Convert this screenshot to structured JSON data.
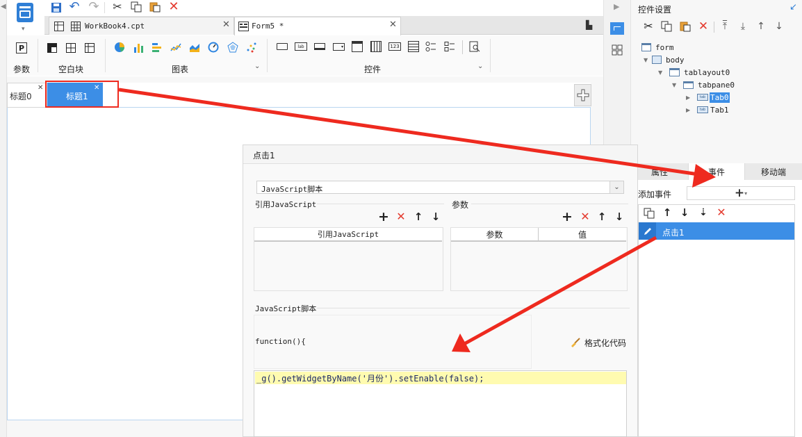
{
  "toolbar": {
    "groups": {
      "params": "参数",
      "blank": "空白块",
      "charts": "图表",
      "widgets": "控件"
    }
  },
  "tabs": [
    {
      "label": "WorkBook4.cpt"
    },
    {
      "label": "Form5 *"
    }
  ],
  "form_tabs": [
    {
      "label": "标题0"
    },
    {
      "label": "标题1"
    }
  ],
  "side": {
    "title": "控件设置",
    "tree": [
      {
        "label": "form"
      },
      {
        "label": "body"
      },
      {
        "label": "tablayout0"
      },
      {
        "label": "tabpane0"
      },
      {
        "label": "Tab0"
      },
      {
        "label": "Tab1"
      }
    ],
    "prop_tabs": [
      "属性",
      "事件",
      "移动端"
    ],
    "add_event_label": "添加事件",
    "event_item": "点击1"
  },
  "dialog": {
    "title": "点击1",
    "type_select": "JavaScript脚本",
    "ref_js_label": "引用JavaScript",
    "params_label": "参数",
    "ref_js_col": "引用JavaScript",
    "param_col": "参数",
    "value_col": "值",
    "script_label": "JavaScript脚本",
    "function_head": "function(){",
    "format_label": "格式化代码",
    "code": "_g().getWidgetByName('月份').setEnable(false);"
  },
  "colors": {
    "accent": "#3c8ee6",
    "arrow": "#ee2a1f",
    "highlight": "#fffbb0"
  }
}
